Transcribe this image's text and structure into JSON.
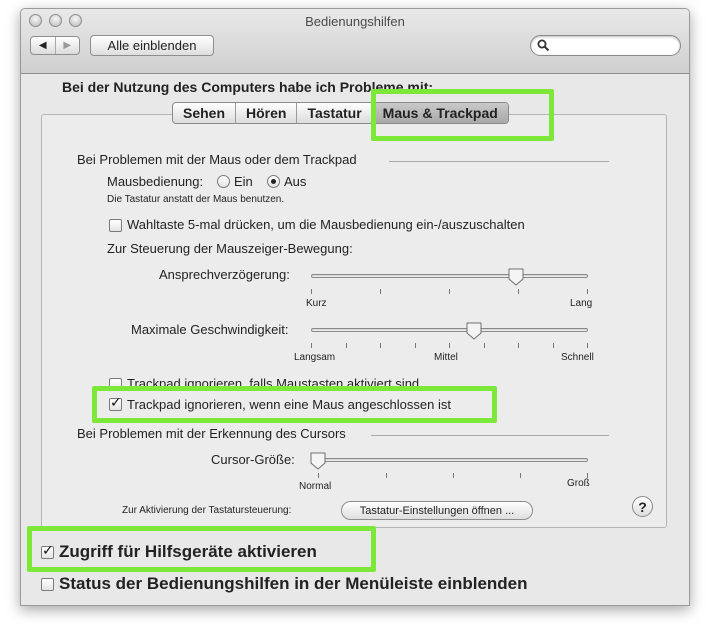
{
  "window": {
    "title": "Bedienungshilfen"
  },
  "toolbar": {
    "back_label": "◀",
    "forward_label": "▶",
    "show_all_label": "Alle einblenden",
    "search": {
      "value": "",
      "placeholder": ""
    }
  },
  "heading": "Bei der Nutzung des Computers habe ich Probleme mit:",
  "tabs": [
    {
      "label": "Sehen",
      "active": false
    },
    {
      "label": "Hören",
      "active": false
    },
    {
      "label": "Tastatur",
      "active": false
    },
    {
      "label": "Maus & Trackpad",
      "active": true
    }
  ],
  "mouse_section": {
    "title": "Bei Problemen mit der Maus oder dem Trackpad",
    "mouse_keys_label": "Mausbedienung:",
    "option_on": "Ein",
    "option_off": "Aus",
    "selected": "Aus",
    "hint": "Die Tastatur anstatt der Maus benutzen.",
    "option_key_toggle": {
      "label": "Wahltaste 5-mal drücken, um die Mausbedienung ein-/auszuschalten",
      "checked": false
    },
    "pointer_control_label": "Zur Steuerung der Mauszeiger-Bewegung:",
    "initial_delay": {
      "label": "Ansprechverzögerung:",
      "min_label": "Kurz",
      "max_label": "Lang",
      "value_fraction": 0.74
    },
    "max_speed": {
      "label": "Maximale Geschwindigkeit:",
      "min_label": "Langsam",
      "mid_label": "Mittel",
      "max_label": "Schnell",
      "value_fraction": 0.59
    },
    "ignore_trackpad_mousekeys": {
      "label": "Trackpad ignorieren, falls Maustasten aktiviert sind",
      "checked": false
    },
    "ignore_trackpad_mouse": {
      "label": "Trackpad ignorieren, wenn eine Maus angeschlossen ist",
      "checked": true
    }
  },
  "cursor_section": {
    "title": "Bei Problemen mit der Erkennung des Cursors",
    "cursor_size": {
      "label": "Cursor-Größe:",
      "min_label": "Normal",
      "max_label": "Groß",
      "value_fraction": 0.0
    },
    "keyboard_access_label": "Zur Aktivierung der Tastatursteuerung:",
    "keyboard_settings_button": "Tastatur-Einstellungen öffnen ..."
  },
  "help_label": "?",
  "bottom": {
    "assistive_devices": {
      "label": "Zugriff für Hilfsgeräte aktivieren",
      "checked": true
    },
    "menu_status": {
      "label": "Status der Bedienungshilfen in der Menüleiste einblenden",
      "checked": false
    }
  },
  "colors": {
    "highlight": "#7ee83a"
  }
}
